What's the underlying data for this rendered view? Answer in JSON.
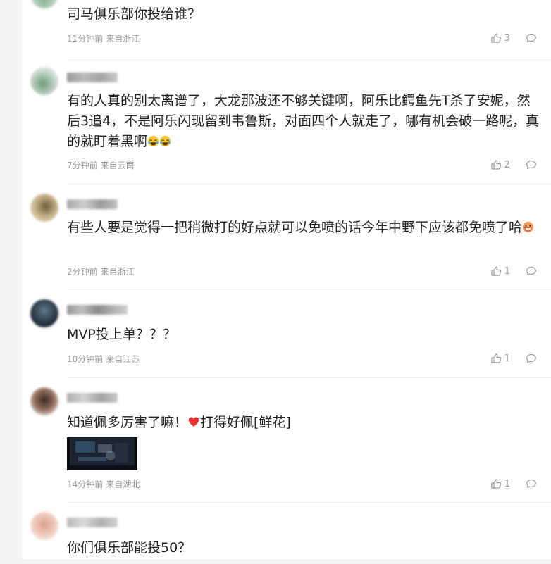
{
  "comments": [
    {
      "text": "司马俱乐部你投给谁？",
      "time": "11分钟前",
      "location": "来自浙江",
      "likes": "3"
    },
    {
      "text": "有的人真的别太离谱了，大龙那波还不够关键啊，阿乐比鳄鱼先T杀了安妮，然后3追4，不是阿乐闪现留到韦鲁斯，对面四个人就走了，哪有机会破一路呢，真的就盯着黑啊",
      "time": "7分钟前",
      "location": "来自云南",
      "likes": "2"
    },
    {
      "text": "有些人要是觉得一把稍微打的好点就可以免喷的话今年中野下应该都免喷了哈",
      "time": "2分钟前",
      "location": "来自浙江",
      "likes": "1"
    },
    {
      "text": "MVP投上单？？？",
      "time": "10分钟前",
      "location": "来自江苏",
      "likes": "1"
    },
    {
      "text_before": "知道佩多厉害了嘛！",
      "text_after": "打得好佩[鲜花]",
      "time": "14分钟前",
      "location": "来自湖北",
      "likes": "1"
    },
    {
      "text": "你们俱乐部能投50？"
    }
  ],
  "icons": {
    "like": "thumbs-up-icon",
    "reply": "comment-bubble-icon",
    "emoji_laugh": "laughing-tears-emoji",
    "emoji_grin": "grinning-emoji",
    "heart": "red-heart-emoji"
  },
  "colors": {
    "text": "#222222",
    "meta": "#999999",
    "heart": "#e8322f"
  }
}
